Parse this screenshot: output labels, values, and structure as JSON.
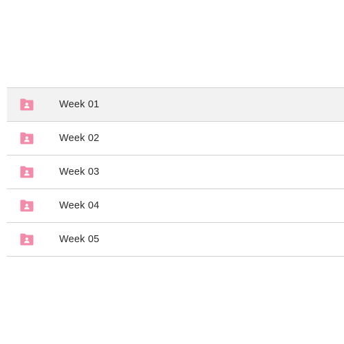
{
  "folders": {
    "icon": "shared-folder-icon",
    "icon_color": "#f38cab",
    "selected_index": 0,
    "items": [
      {
        "label": "Week 01"
      },
      {
        "label": "Week 02"
      },
      {
        "label": "Week 03"
      },
      {
        "label": "Week 04"
      },
      {
        "label": "Week 05"
      }
    ]
  }
}
